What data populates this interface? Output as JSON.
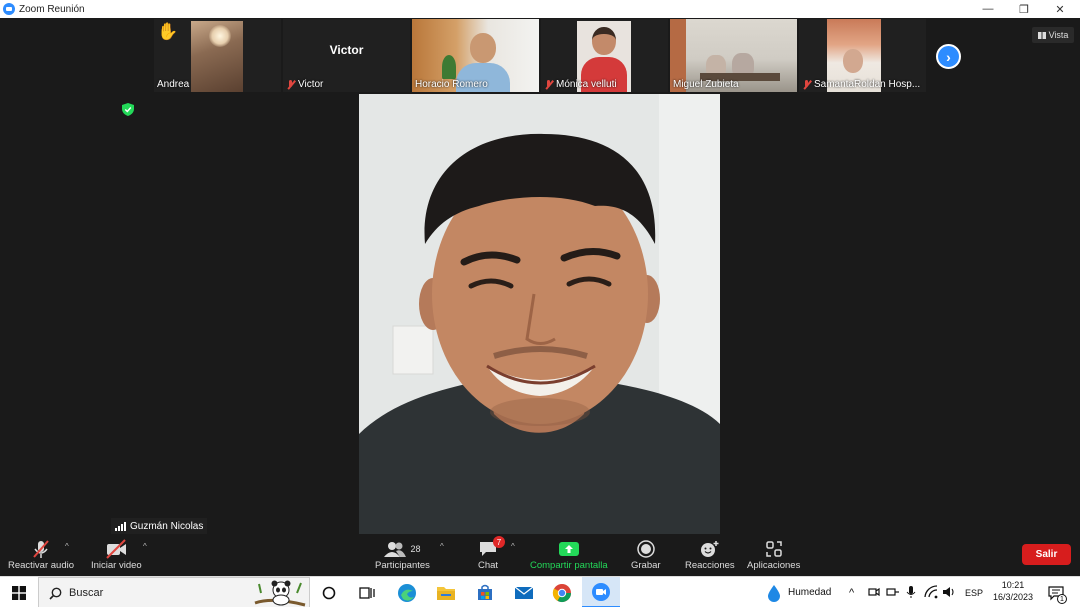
{
  "window": {
    "title": "Zoom Reunión",
    "controls": [
      "—",
      "❐",
      "✕"
    ]
  },
  "thumbnails": [
    {
      "name": "Andrea",
      "raised_hand": true,
      "muted": false
    },
    {
      "name": "Victor",
      "big_label": "Victor",
      "muted": true
    },
    {
      "name": "Horacio Romero",
      "muted": false
    },
    {
      "name": "Mónica velluti",
      "muted": true
    },
    {
      "name": "Miguel Zubieta",
      "muted": false
    },
    {
      "name": "SamantaRoldan Hosp...",
      "muted": true
    }
  ],
  "view_button": {
    "label": "Vista"
  },
  "speaker": {
    "name": "Guzmán Nicolas"
  },
  "toolbar": {
    "audio_label": "Reactivar audio",
    "video_label": "Iniciar video",
    "participants_label": "Participantes",
    "participants_count": "28",
    "chat_label": "Chat",
    "chat_badge": "7",
    "share_label": "Compartir pantalla",
    "record_label": "Grabar",
    "reactions_label": "Reacciones",
    "apps_label": "Aplicaciones",
    "leave_label": "Salir"
  },
  "taskbar": {
    "search_placeholder": "Buscar",
    "weather": "Humedad",
    "language": "ESP",
    "time": "10:21",
    "date": "16/3/2023",
    "notifications": "1"
  },
  "colors": {
    "accent": "#2d8cff",
    "share_green": "#23d959",
    "leave_red": "#d71d1d",
    "muted_red": "#e0463f"
  }
}
